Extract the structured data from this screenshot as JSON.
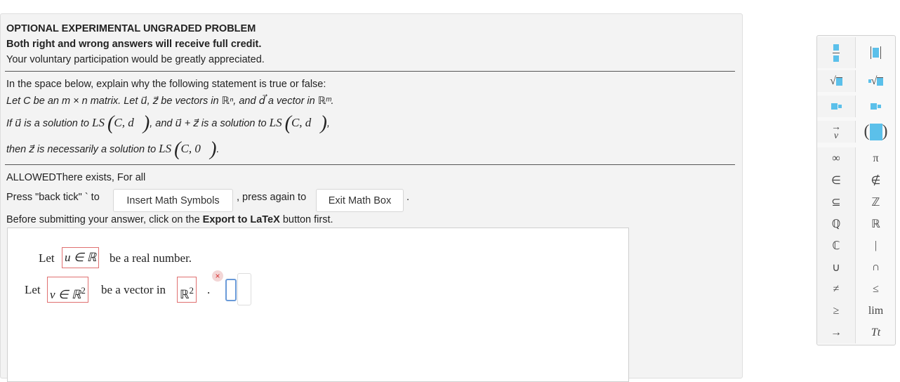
{
  "header": {
    "title": "OPTIONAL EXPERIMENTAL UNGRADED PROBLEM",
    "subtitle": "Both right and wrong answers will receive full credit.",
    "note": "Your voluntary participation would be greatly appreciated."
  },
  "problem": {
    "intro": "In the space below, explain why the following statement is true or false:",
    "line1": "Let C be an m × n matrix. Let u⃗, z⃗ be vectors in ℝⁿ, and d⃗ a vector in ℝᵐ.",
    "line2_a": "If u⃗ is a solution to",
    "line2_b": "LS",
    "line2_c": "C, d⃗",
    "line2_d": ", and u⃗ + z⃗ is a solution to",
    "line2_e": "LS",
    "line2_f": "C, d⃗",
    "line2_g": ",",
    "line3_a": "then z⃗ is necessarily a solution to",
    "line3_b": "LS",
    "line3_c": "C, 0⃗",
    "line3_d": "."
  },
  "allowed": {
    "label": "ALLOWEDThere exists, For all"
  },
  "instructions": {
    "press_back_tick": "Press \"back tick\" ` to",
    "insert_button": "Insert Math Symbols",
    "press_again": ", press again to",
    "exit_button": "Exit Math Box",
    "period": ".",
    "before_a": "Before submitting your answer, click on the",
    "before_b": "Export to LaTeX",
    "before_c": "button first."
  },
  "editor": {
    "row1_let": "Let",
    "row1_math": "u ∈ ℝ",
    "row1_rest": "be a real number.",
    "row2_let": "Let",
    "row2_math": "v ∈ ℝ",
    "row2_sup": "2",
    "row2_mid": "be a vector in",
    "row2_math2": "ℝ",
    "row2_sup2": "2",
    "row2_dot": ".",
    "close_symbol": "×"
  },
  "palette": {
    "items": [
      [
        "fraction",
        "stacked-box"
      ],
      [
        "√",
        "ⁿ√"
      ],
      [
        "superscript",
        "subscript"
      ],
      [
        "→ v",
        "( )"
      ],
      [
        "∞",
        "π"
      ],
      [
        "∈",
        "∉"
      ],
      [
        "⊆",
        "ℤ"
      ],
      [
        "ℚ",
        "ℝ"
      ],
      [
        "ℂ",
        "|"
      ],
      [
        "∪",
        "∩"
      ],
      [
        "≠",
        "≤"
      ],
      [
        "≥",
        "lim"
      ],
      [
        "→",
        "Tt"
      ]
    ],
    "accent_color": "#5bc0ea"
  }
}
